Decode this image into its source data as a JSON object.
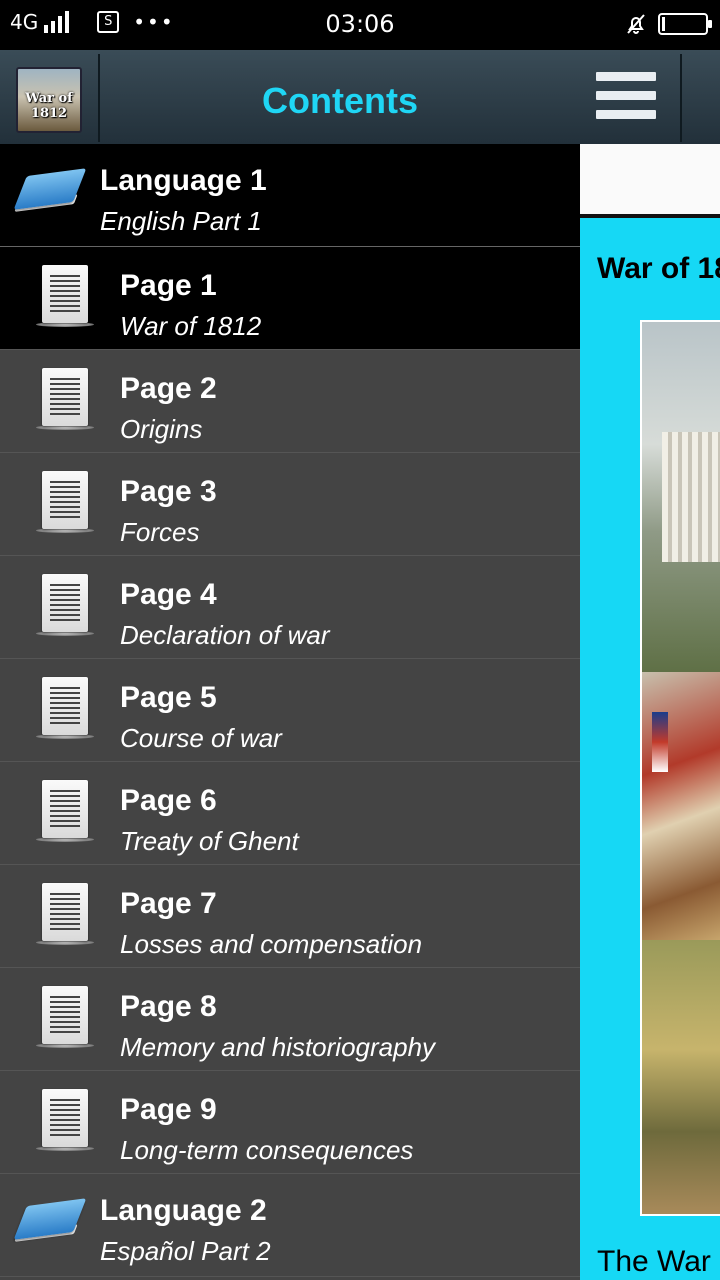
{
  "status_bar": {
    "network": "4G",
    "sim_badge": "S",
    "more": "•••",
    "time": "03:06"
  },
  "drawer": {
    "app_thumb_label": "War of 1812",
    "title": "Contents",
    "items": [
      {
        "type": "language",
        "title": "Language 1",
        "subtitle": "English Part 1",
        "icon": "book-icon"
      },
      {
        "type": "page",
        "title": "Page 1",
        "subtitle": "War of 1812",
        "icon": "document-icon",
        "selected": true
      },
      {
        "type": "page",
        "title": "Page 2",
        "subtitle": "Origins",
        "icon": "document-icon"
      },
      {
        "type": "page",
        "title": "Page 3",
        "subtitle": "Forces",
        "icon": "document-icon"
      },
      {
        "type": "page",
        "title": "Page 4",
        "subtitle": "Declaration of war",
        "icon": "document-icon"
      },
      {
        "type": "page",
        "title": "Page 5",
        "subtitle": "Course of war",
        "icon": "document-icon"
      },
      {
        "type": "page",
        "title": "Page 6",
        "subtitle": "Treaty of Ghent",
        "icon": "document-icon"
      },
      {
        "type": "page",
        "title": "Page 7",
        "subtitle": "Losses and compensation",
        "icon": "document-icon"
      },
      {
        "type": "page",
        "title": "Page 8",
        "subtitle": "Memory and historiography",
        "icon": "document-icon"
      },
      {
        "type": "page",
        "title": "Page 9",
        "subtitle": "Long-term consequences",
        "icon": "document-icon"
      },
      {
        "type": "language",
        "title": "Language 2",
        "subtitle": "Español Part 2",
        "icon": "book-icon"
      }
    ]
  },
  "main": {
    "article_title": "War of 18",
    "article_text": "The War"
  },
  "colors": {
    "accent": "#1fd6f5",
    "drawer_bg": "#444444",
    "selected_bg": "#000000",
    "content_bg": "#16d8f5"
  }
}
